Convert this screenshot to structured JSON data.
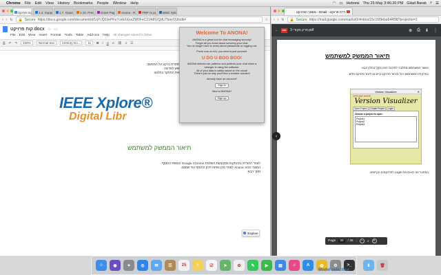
{
  "menubar": {
    "app": "Chrome",
    "items": [
      "File",
      "Edit",
      "View",
      "History",
      "Bookmarks",
      "People",
      "Window",
      "Help"
    ],
    "language": "Hebrew",
    "datetime": "Thu 25 May  3:46:20 PM",
    "user": "Gilad Barak"
  },
  "left_browser": {
    "tabs": [
      {
        "label": "קוח פרויקט.doc",
        "color": "#4285f4"
      },
      {
        "label": "1.4. Support",
        "color": "#1a73e8"
      },
      {
        "label": "1.7. Gaussian",
        "color": "#1a73e8"
      },
      {
        "label": "1.10. Precis",
        "color": "#ef6c00"
      },
      {
        "label": "Grant Page",
        "color": "#9c27b0"
      },
      {
        "label": "Anona - Res",
        "color": "#e8622a"
      },
      {
        "label": "TRIF to pdf",
        "color": "#d93025"
      },
      {
        "label": "IEEE Xplore",
        "color": "#1b6aa9"
      }
    ],
    "secure_label": "Secure",
    "url": "https://docs.google.com/document/d/1qYcQ03ePKe7ceE6XoxZW0FeC214dhVQdU7bavOUIsdk#",
    "doc_title": "קוח פרויקט.docx",
    "doc_menu": [
      "File",
      "Edit",
      "View",
      "Insert",
      "Format",
      "Tools",
      "Table",
      "Add-ons",
      "Help"
    ],
    "saved_status": "All changes saved in Drive",
    "toolbar": {
      "zoom": "100%",
      "style": "Normal text",
      "font": "Century Go...",
      "size": "11"
    },
    "doc_text_lines_top": [
      "המשתמש רואה את האלגוריתם בפעולה ושיטת הצפנה אשר מוסתרת ברקע על המחשב",
      "בעזרת Anona ניתן להצפין הודעות בין משתמשים שונים ללא חשש לפריצה",
      "IEEE ניתן לשתף ולשמור את התוצאות במערכת ובכך להראות את המחקר במלואו"
    ],
    "ieee_line1": "IEEE Xplore®",
    "ieee_line2": "Digital Libr",
    "doc_heading": "תיאור הממשק למשתמש",
    "doc_text_lines_bottom": [
      "לאחר ההורדה וההתקנה מתבצעת השלמת Google Chrome הוספת התוסף",
      "המוצר הבא: Anona לאחר מכן נפתח חלון התוסף כפי שמוצג",
      "מסך הבא:"
    ],
    "explore_label": "Explore"
  },
  "anona_popup": {
    "welcome": "Welcome To ANONA!",
    "intro_lines": [
      "ANONA is a great tool for chat messaging security!",
      "Forget all you know about securing your chat.",
      "You no longer have to worry about passwords or logging out."
    ],
    "prove": "Prove now on ALL you need is just yourself.",
    "uboo": "U DO U BOO BOO!",
    "detect_lines": [
      "ANONA detects use patterns and protects your chat when a stranger is using the software.",
      "All of your data is safely saved on the cloud!",
      "There's just no way you'll find a smarter solution!"
    ],
    "already": "Already have an account?",
    "sign_in": "Sign in",
    "new_to": "New to ANONA?",
    "sign_up": "Sign up"
  },
  "right_browser": {
    "tab_label": "דו\"ח פרויקט - Gmail - מסמך הפרויקט",
    "secure_label": "Secure",
    "url": "https://mail.google.com/mail/u/0/#inbox/15c16f9eba6445f8?projector=1",
    "pdf_name": "3 פרק מקורי.pdf",
    "pdf_heading": "תיאור הממשק למשתמש",
    "pdf_text_lines": [
      "כאשר המשתמש מתחבר לתוכנה הוא נתקל בחלון הבא:",
      "בחלון זה המשתמש יכול לבחור פרויקט קיים או ליצור פרויקט חדש."
    ],
    "pdf_text_bottom": "במחבר ואז רואים את Login לפרויקטים הקיימים.",
    "page_label": "Page",
    "page_current": "30",
    "page_total": "/ 35",
    "zoom_minus": "−",
    "zoom_plus": "+"
  },
  "version_visualizer": {
    "window_title": "Version Visualizer",
    "brand": "OFFLINE MODE",
    "title": "Version Visualizer",
    "tabs": [
      "Open Project",
      "Create Project",
      "Login"
    ],
    "panel_label": "Choose a project to open:",
    "projects": [
      "Project1",
      "Project2",
      "Project3"
    ]
  },
  "dock": {
    "items": [
      {
        "name": "finder-icon",
        "color": "#3d8ee8",
        "glyph": "☺"
      },
      {
        "name": "siri-icon",
        "color": "#6b4fbf",
        "glyph": "◉"
      },
      {
        "name": "launchpad-icon",
        "color": "#8a8a8a",
        "glyph": "✦"
      },
      {
        "name": "safari-icon",
        "color": "#2f84e6",
        "glyph": "◎"
      },
      {
        "name": "mail-icon",
        "color": "#5fa8ee",
        "glyph": "✉"
      },
      {
        "name": "contacts-icon",
        "color": "#b08a5a",
        "glyph": "☰"
      },
      {
        "name": "calendar-icon",
        "color": "#f2f2f2",
        "glyph": "25"
      },
      {
        "name": "notes-icon",
        "color": "#f2d25a",
        "glyph": "≡"
      },
      {
        "name": "reminders-icon",
        "color": "#f4f4f4",
        "glyph": "☑"
      },
      {
        "name": "maps-icon",
        "color": "#66b36a",
        "glyph": "➤"
      },
      {
        "name": "photos-icon",
        "color": "#f0f0f0",
        "glyph": "✿"
      },
      {
        "name": "messages-icon",
        "color": "#35c759",
        "glyph": "✎"
      },
      {
        "name": "facetime-icon",
        "color": "#3cb94a",
        "glyph": "▶"
      },
      {
        "name": "keynote-icon",
        "color": "#3f88e3",
        "glyph": "▤"
      },
      {
        "name": "itunes-icon",
        "color": "#e9488c",
        "glyph": "♫"
      },
      {
        "name": "appstore-icon",
        "color": "#2d8de8",
        "glyph": "A"
      },
      {
        "name": "chrome-icon",
        "color": "#e8b92e",
        "glyph": "◍"
      },
      {
        "name": "preferences-icon",
        "color": "#8c8c8c",
        "glyph": "⚙"
      },
      {
        "name": "terminal-icon",
        "color": "#333333",
        "glyph": ">_"
      }
    ],
    "trailing": [
      {
        "name": "downloads-folder-icon",
        "color": "#6cb4ee",
        "glyph": "⬇"
      },
      {
        "name": "trash-icon",
        "color": "#c9c9c9",
        "glyph": "🗑"
      }
    ]
  },
  "background_label": "Model selection"
}
